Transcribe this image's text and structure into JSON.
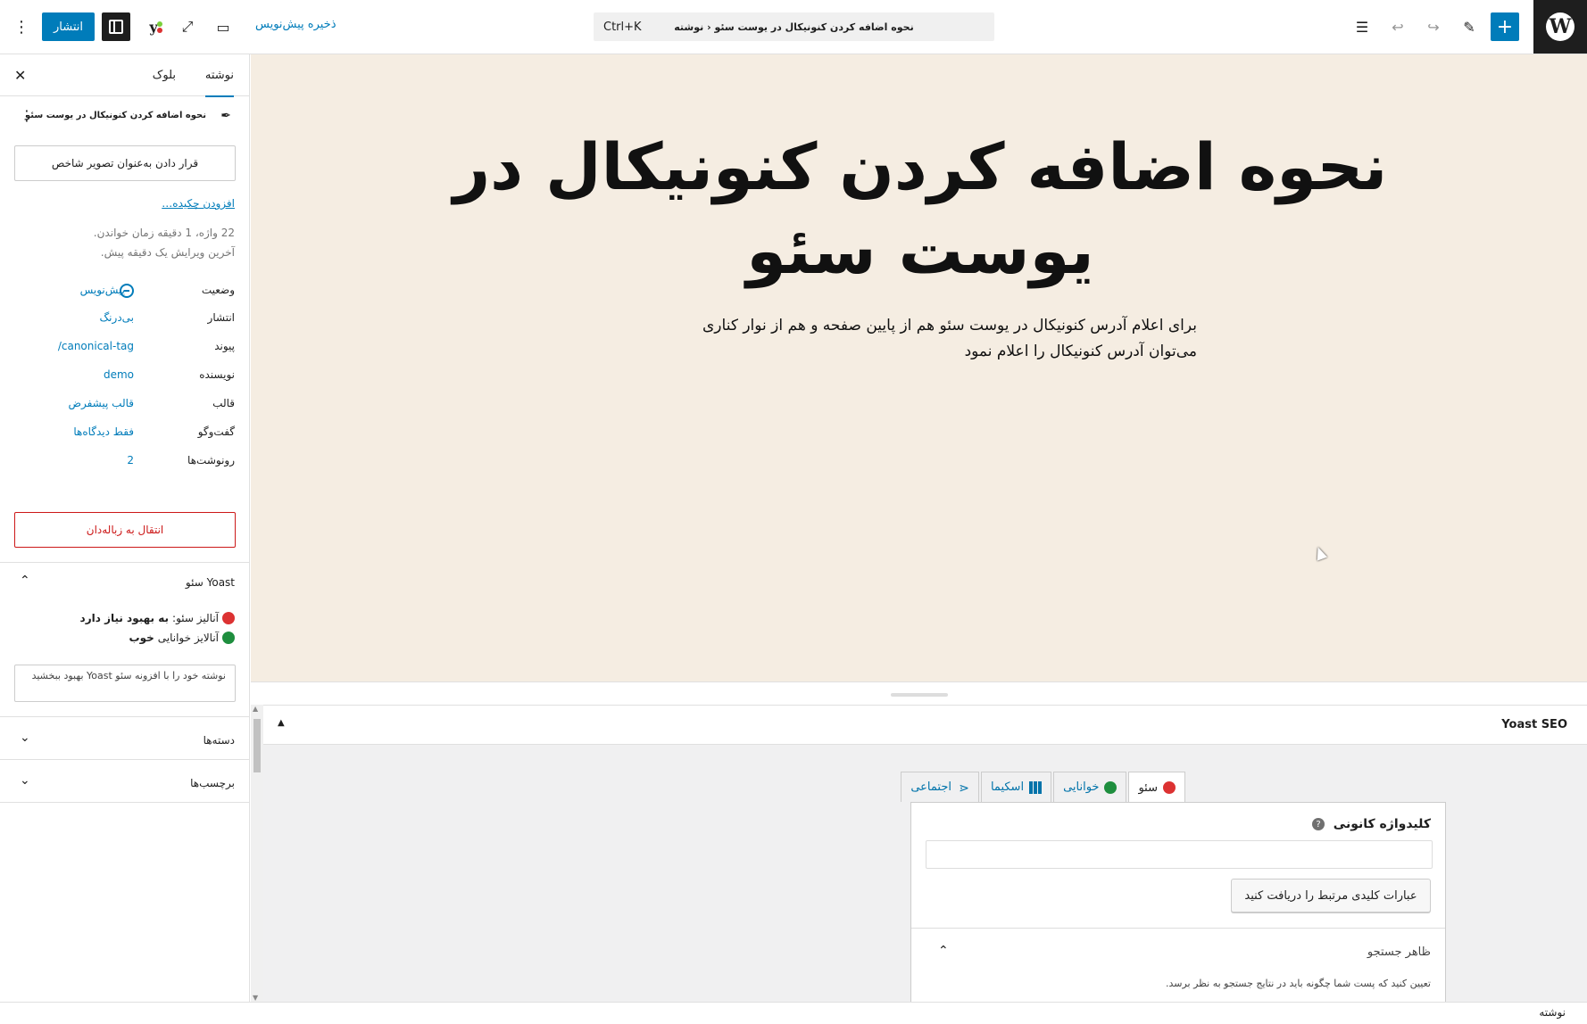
{
  "topbar": {
    "document_title": "نحوه اضافه کردن کنونیکال در یوست سئو ‹ نوشته",
    "shortcut": "Ctrl+K",
    "save_draft": "ذخیره پیش‌نویس",
    "publish": "انتشار"
  },
  "sidebar": {
    "tab_post": "نوشته",
    "tab_block": "بلوک",
    "post_title": "نحوه اضافه کردن کنونیکال در یوست سئو",
    "featured_image_button": "قرار دادن به‌عنوان تصویر شاخص",
    "add_excerpt": "افزودن چکیده…",
    "meta_words": "22 واژه، 1 دقیقه زمان خواندن.",
    "meta_edited": "آخرین ویرایش یک دقیقه پیش.",
    "rows": [
      {
        "label": "وضعیت",
        "value": "پیش‌نویس"
      },
      {
        "label": "انتشار",
        "value": "بی‌درنگ"
      },
      {
        "label": "پیوند",
        "value": "/canonical-tag"
      },
      {
        "label": "نویسنده",
        "value": "demo"
      },
      {
        "label": "قالب",
        "value": "قالب پیشفرض"
      },
      {
        "label": "گفت‌وگو",
        "value": "فقط دیدگاه‌ها"
      },
      {
        "label": "رونوشت‌ها",
        "value": "2"
      }
    ],
    "trash_button": "انتقال به زباله‌دان",
    "yoast_panel_title": "Yoast سئو",
    "seo_analysis_label": "آنالیز سئو:",
    "seo_analysis_value": "به بهبود نیاز دارد",
    "readability_label": "آنالایز خوانایی",
    "readability_value": "خوب",
    "improve_text": "نوشته خود را با افزونه سئو Yoast بهبود ببخشید",
    "categories_title": "دسته‌ها",
    "tags_title": "برچسب‌ها"
  },
  "canvas": {
    "title": "نحوه اضافه کردن کنونیکال در یوست سئو",
    "excerpt": "برای اعلام آدرس کنونیکال در یوست سئو هم از پایین صفحه و هم از نوار کناری می‌توان آدرس کنونیکال را اعلام نمود"
  },
  "metabox": {
    "title": "Yoast SEO",
    "tabs": [
      "سئو",
      "خوانایی",
      "اسکیما",
      "اجتماعی"
    ],
    "focus_keyword_label": "کلیدواژه کانونی",
    "related_button": "عبارات کلیدی مرتبط را دریافت کنید",
    "search_appearance_title": "ظاهر جستجو",
    "search_appearance_desc": "تعیین کنید که پست شما چگونه باید در نتایج جستجو به نظر برسد."
  },
  "footer": {
    "breadcrumb": "نوشته"
  },
  "colors": {
    "accent": "#007cba",
    "canvas_bg": "#f5ede2",
    "danger": "#cc1818"
  }
}
